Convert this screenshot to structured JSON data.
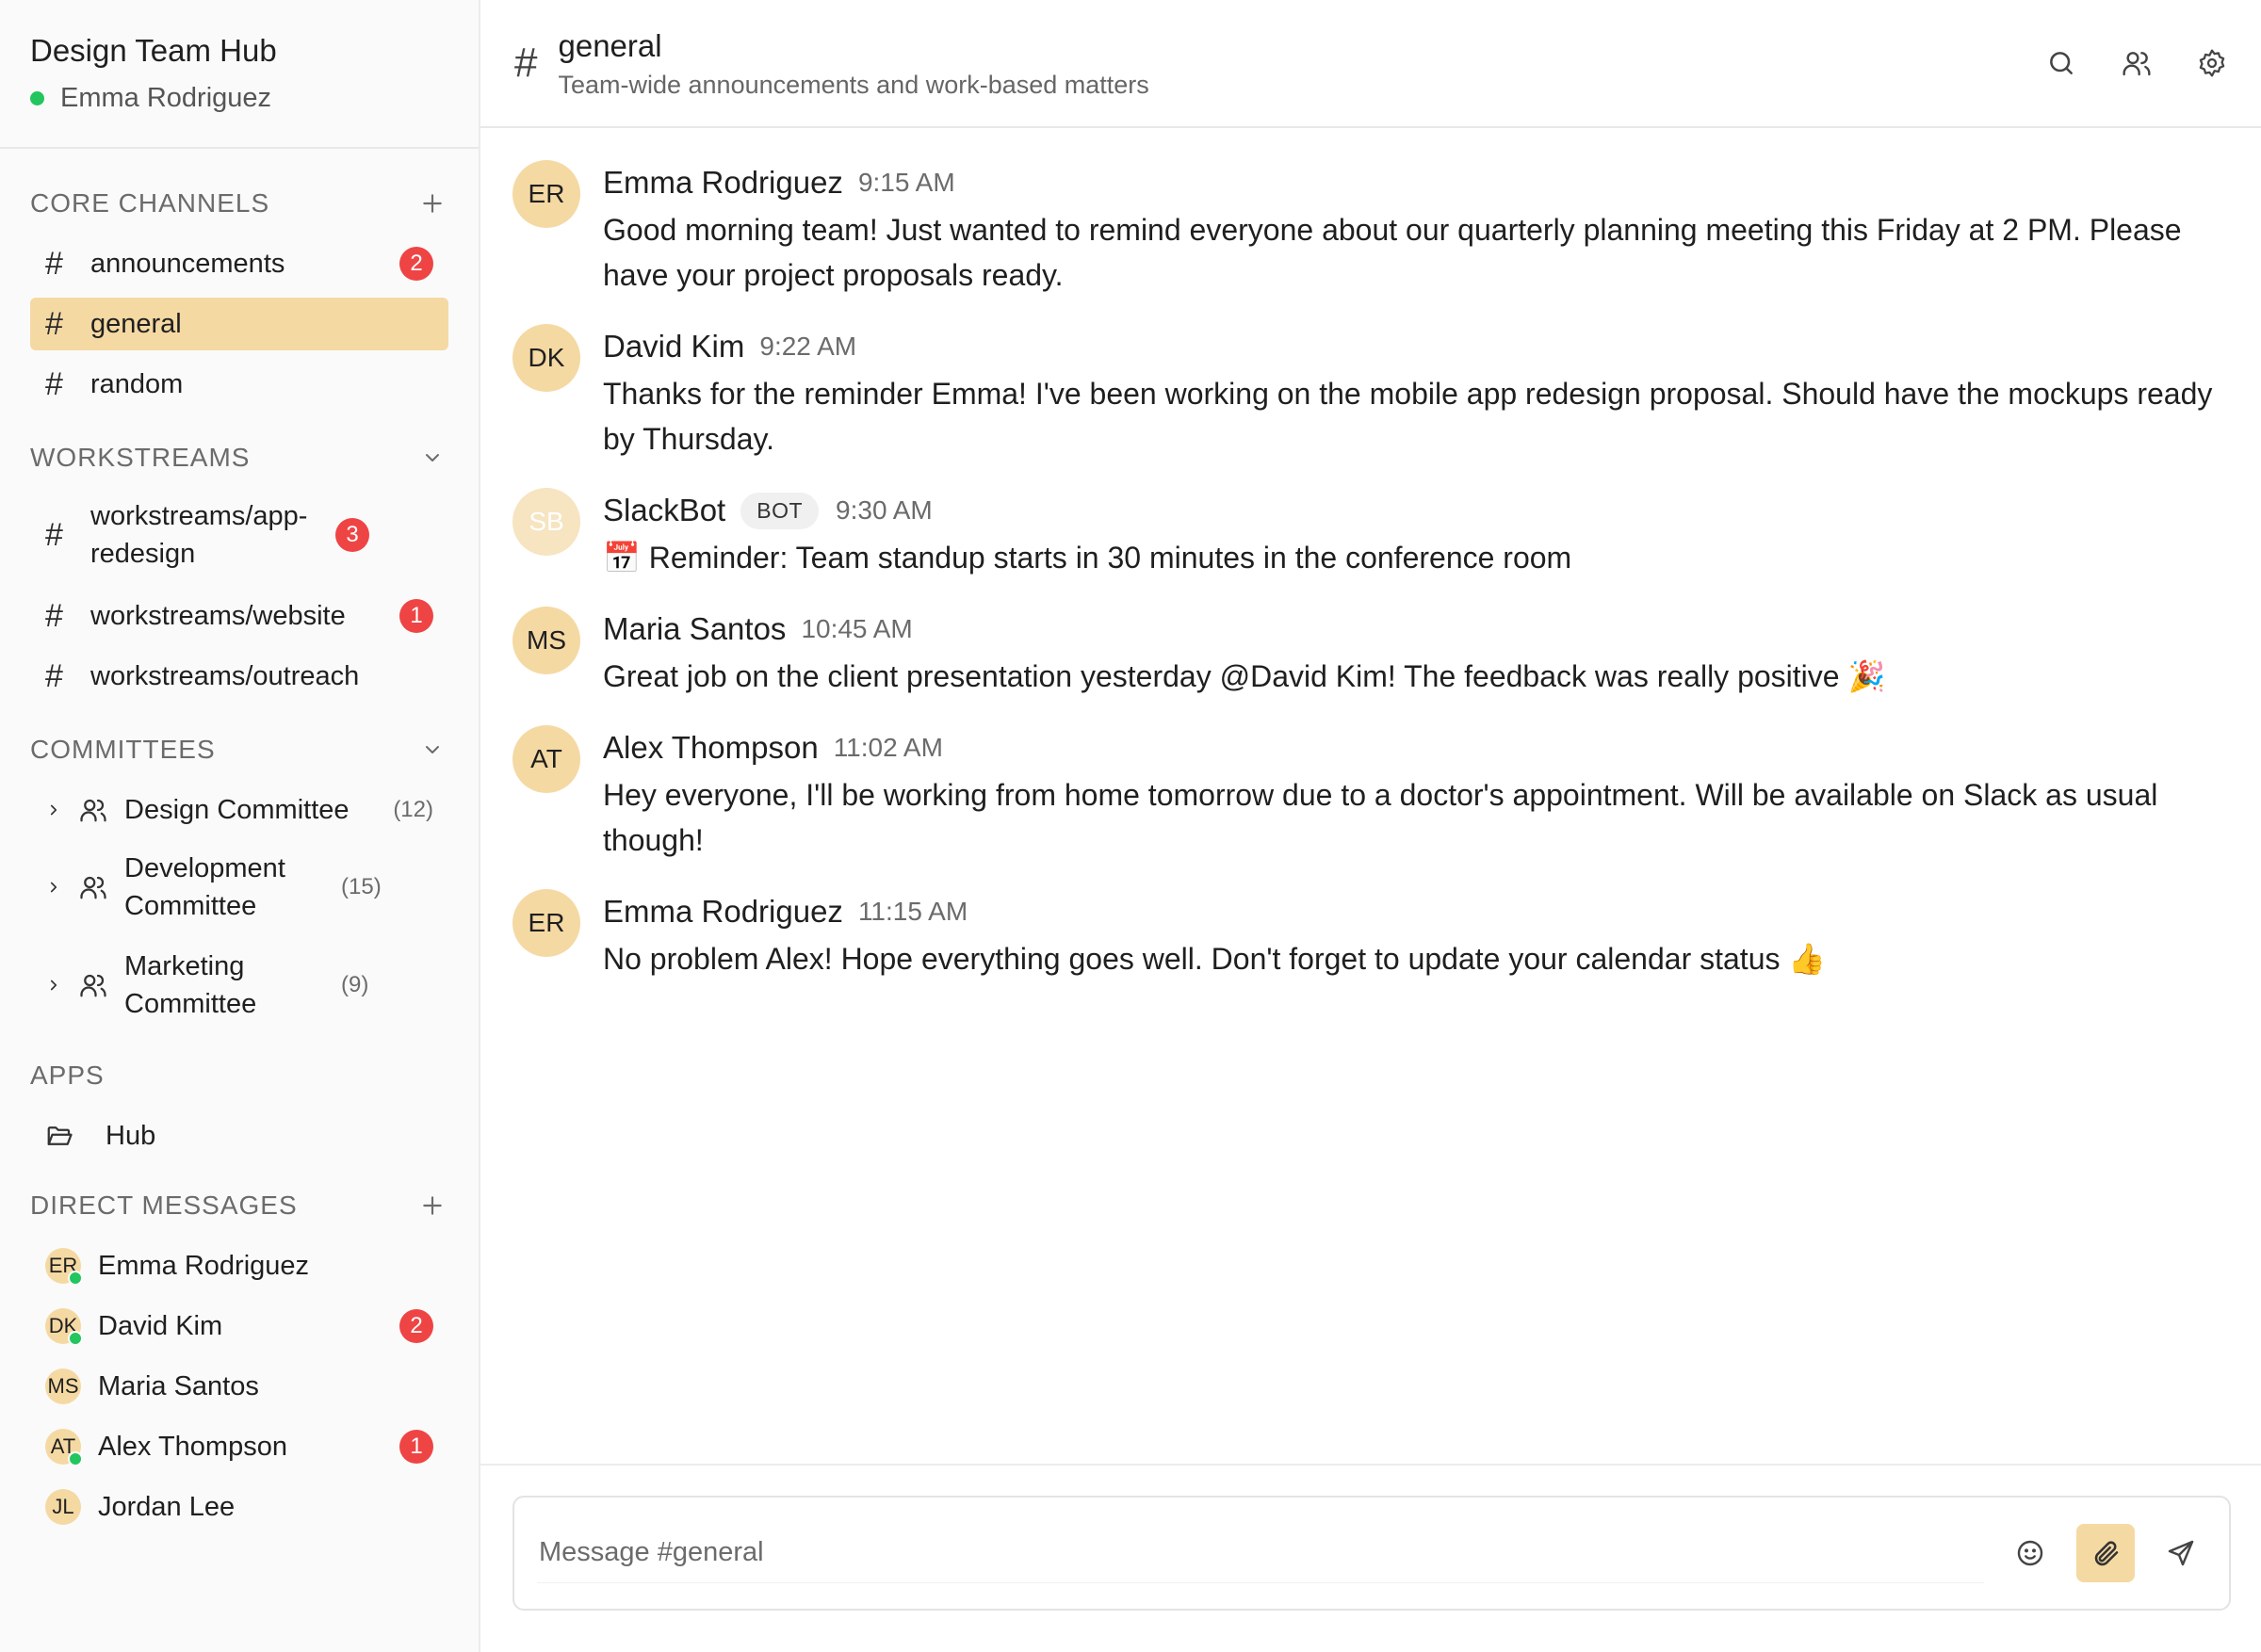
{
  "workspace": {
    "name": "Design Team Hub",
    "user": "Emma Rodriguez"
  },
  "sections": {
    "core": {
      "title": "CORE CHANNELS",
      "items": [
        {
          "label": "announcements",
          "badge": "2"
        },
        {
          "label": "general"
        },
        {
          "label": "random"
        }
      ]
    },
    "workstreams": {
      "title": "WORKSTREAMS",
      "items": [
        {
          "label": "workstreams/app-redesign",
          "badge": "3"
        },
        {
          "label": "workstreams/website",
          "badge": "1"
        },
        {
          "label": "workstreams/outreach"
        }
      ]
    },
    "committees": {
      "title": "COMMITTEES",
      "items": [
        {
          "label": "Design Committee",
          "count": "(12)"
        },
        {
          "label": "Development Committee",
          "count": "(15)"
        },
        {
          "label": "Marketing Committee",
          "count": "(9)"
        }
      ]
    },
    "apps": {
      "title": "APPS",
      "items": [
        {
          "label": "Hub"
        }
      ]
    },
    "dms": {
      "title": "DIRECT MESSAGES",
      "items": [
        {
          "initials": "ER",
          "label": "Emma Rodriguez"
        },
        {
          "initials": "DK",
          "label": "David Kim",
          "badge": "2"
        },
        {
          "initials": "MS",
          "label": "Maria Santos"
        },
        {
          "initials": "AT",
          "label": "Alex Thompson",
          "badge": "1"
        },
        {
          "initials": "JL",
          "label": "Jordan Lee"
        }
      ]
    }
  },
  "channel": {
    "hash": "#",
    "name": "general",
    "description": "Team-wide announcements and work-based matters"
  },
  "messages": [
    {
      "initials": "ER",
      "author": "Emma Rodriguez",
      "time": "9:15 AM",
      "text": "Good morning team! Just wanted to remind everyone about our quarterly planning meeting this Friday at 2 PM. Please have your project proposals ready."
    },
    {
      "initials": "DK",
      "author": "David Kim",
      "time": "9:22 AM",
      "text": "Thanks for the reminder Emma! I've been working on the mobile app redesign proposal. Should have the mockups ready by Thursday."
    },
    {
      "initials": "SB",
      "author": "SlackBot",
      "tag": "BOT",
      "time": "9:30 AM",
      "text": "📅 Reminder: Team standup starts in 30 minutes in the conference room"
    },
    {
      "initials": "MS",
      "author": "Maria Santos",
      "time": "10:45 AM",
      "text": "Great job on the client presentation yesterday @David Kim! The feedback was really positive 🎉"
    },
    {
      "initials": "AT",
      "author": "Alex Thompson",
      "time": "11:02 AM",
      "text": "Hey everyone, I'll be working from home tomorrow due to a doctor's appointment. Will be available on Slack as usual though!"
    },
    {
      "initials": "ER",
      "author": "Emma Rodriguez",
      "time": "11:15 AM",
      "text": "No problem Alex! Hope everything goes well. Don't forget to update your calendar status 👍"
    }
  ],
  "composer": {
    "placeholder": "Message #general"
  },
  "colors": {
    "accent": "#f5d9a3",
    "badge": "#ef4444",
    "online": "#22c55e"
  }
}
